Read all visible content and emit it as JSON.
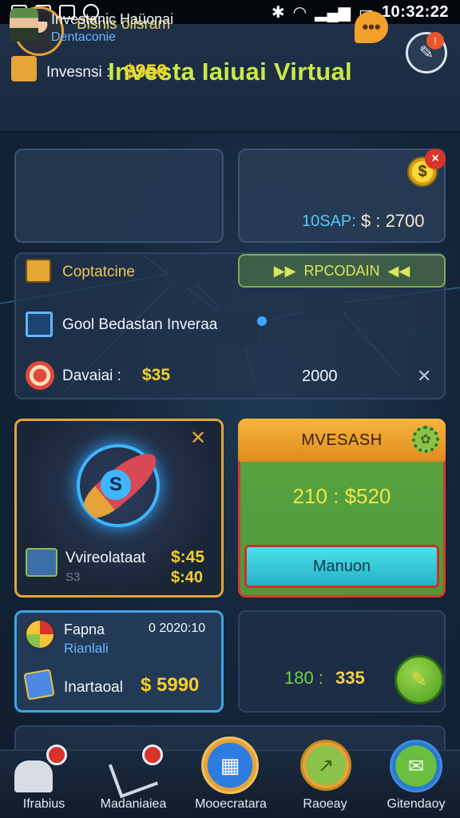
{
  "status_bar": {
    "time": "10:32:22"
  },
  "header": {
    "player_name": "Bisnis oiisram",
    "title": "Investa Iaiuai Virtual",
    "chat_icon": "•••",
    "edit_badge": "!"
  },
  "card_investor": {
    "title": "Investanic Haüonai",
    "subtitle": "Dentaconie",
    "label": "Invesnsi :",
    "value": "$950"
  },
  "card_code": {
    "coin_symbol": "$",
    "close_symbol": "×",
    "code": "10SAP:",
    "value": "$ : 2700"
  },
  "middle": {
    "row1_label": "Coptatcine",
    "pill_label": "RPCODAIN",
    "row2_label": "Gool Bedastan Inveraa",
    "row3_label": "Davaiai :",
    "row3_value": "$35",
    "row3_right": "2000",
    "close_symbol": "✕"
  },
  "rocket_card": {
    "close_symbol": "✕",
    "rocket_letter": "S",
    "label": "Vvireolataat",
    "value1": "$:45",
    "sub": "S3",
    "value2": "$:40"
  },
  "green_card": {
    "header": "MVESASH",
    "value": "210 : $520",
    "button": "Manuon"
  },
  "fapns_card": {
    "title": "Fapna",
    "date": "0 2020:10",
    "subtitle": "Rianlali",
    "label": "Inartaoal",
    "value": "$ 5990"
  },
  "right_bottom": {
    "value1": "180 :",
    "value2": "335"
  },
  "nav": [
    {
      "label": "Ifrabius"
    },
    {
      "label": "Madaniaiea"
    },
    {
      "label": "Mooecratara"
    },
    {
      "label": "Raoeay"
    },
    {
      "label": "Gitendaoy"
    }
  ],
  "colors": {
    "accent_yellow": "#f5cf2a",
    "title_green": "#c9e84a",
    "card_border_gold": "#e2a53a",
    "card_border_blue": "#3ea6e8",
    "button_cyan": "#48e0e8",
    "alert_red": "#d9342a"
  },
  "icons": {
    "status_left": [
      "image-icon",
      "image-icon",
      "chat-icon",
      "notification-icon"
    ],
    "header": [
      "chat-bubble-icon",
      "edit-icon"
    ],
    "nav": [
      "home-icon",
      "tools-icon",
      "grid-icon",
      "chart-icon",
      "mail-icon"
    ]
  }
}
